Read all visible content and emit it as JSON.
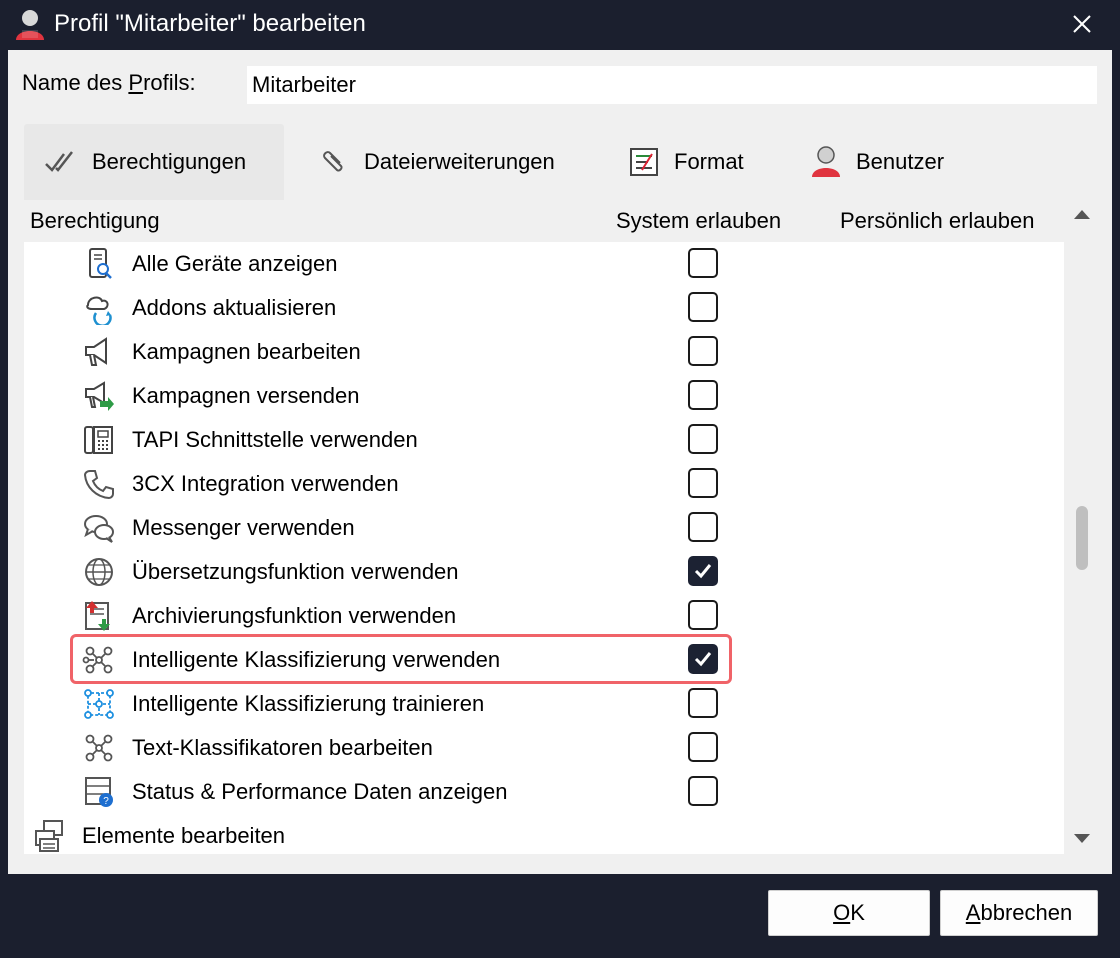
{
  "window": {
    "title": "Profil \"Mitarbeiter\" bearbeiten",
    "title_icon": "user-icon",
    "close_icon": "close-icon"
  },
  "profile": {
    "name_label_pre": "Name des ",
    "name_label_access": "P",
    "name_label_post": "rofils:",
    "name_value": "Mitarbeiter"
  },
  "tabs": [
    {
      "label": "Berechtigungen",
      "icon": "double-check-icon",
      "active": true
    },
    {
      "label": "Dateierweiterungen",
      "icon": "paperclip-icon",
      "active": false
    },
    {
      "label": "Format",
      "icon": "format-icon",
      "active": false
    },
    {
      "label": "Benutzer",
      "icon": "user-icon",
      "active": false
    }
  ],
  "table": {
    "columns": {
      "permission": "Berechtigung",
      "system": "System erlauben",
      "personal": "Persönlich erlauben"
    },
    "rows": [
      {
        "label": "Alle Geräte anzeigen",
        "icon": "device-search-icon",
        "checked": false
      },
      {
        "label": "Addons aktualisieren",
        "icon": "addon-refresh-icon",
        "checked": false
      },
      {
        "label": "Kampagnen bearbeiten",
        "icon": "megaphone-icon",
        "checked": false
      },
      {
        "label": "Kampagnen versenden",
        "icon": "megaphone-send-icon",
        "checked": false
      },
      {
        "label": "TAPI Schnittstelle verwenden",
        "icon": "phone-device-icon",
        "checked": false
      },
      {
        "label": "3CX Integration verwenden",
        "icon": "phone-handset-icon",
        "checked": false
      },
      {
        "label": "Messenger verwenden",
        "icon": "chat-bubbles-icon",
        "checked": false
      },
      {
        "label": "Übersetzungsfunktion verwenden",
        "icon": "globe-icon",
        "checked": true
      },
      {
        "label": "Archivierungsfunktion verwenden",
        "icon": "archive-arrows-icon",
        "checked": false
      },
      {
        "label": "Intelligente Klassifizierung verwenden",
        "icon": "network-icon",
        "checked": true,
        "highlighted": true
      },
      {
        "label": "Intelligente Klassifizierung trainieren",
        "icon": "network-train-icon",
        "checked": false
      },
      {
        "label": "Text-Klassifikatoren bearbeiten",
        "icon": "network-icon",
        "checked": false
      },
      {
        "label": "Status & Performance Daten anzeigen",
        "icon": "server-info-icon",
        "checked": false
      }
    ],
    "group": {
      "label": "Elemente bearbeiten",
      "icon": "elements-icon"
    }
  },
  "buttons": {
    "ok_access": "O",
    "ok_rest": "K",
    "cancel_access": "A",
    "cancel_rest": "bbrechen"
  },
  "colors": {
    "titlebar": "#1b1f2e",
    "highlight": "#f06368",
    "checkbox_checked": "#1c2233"
  }
}
